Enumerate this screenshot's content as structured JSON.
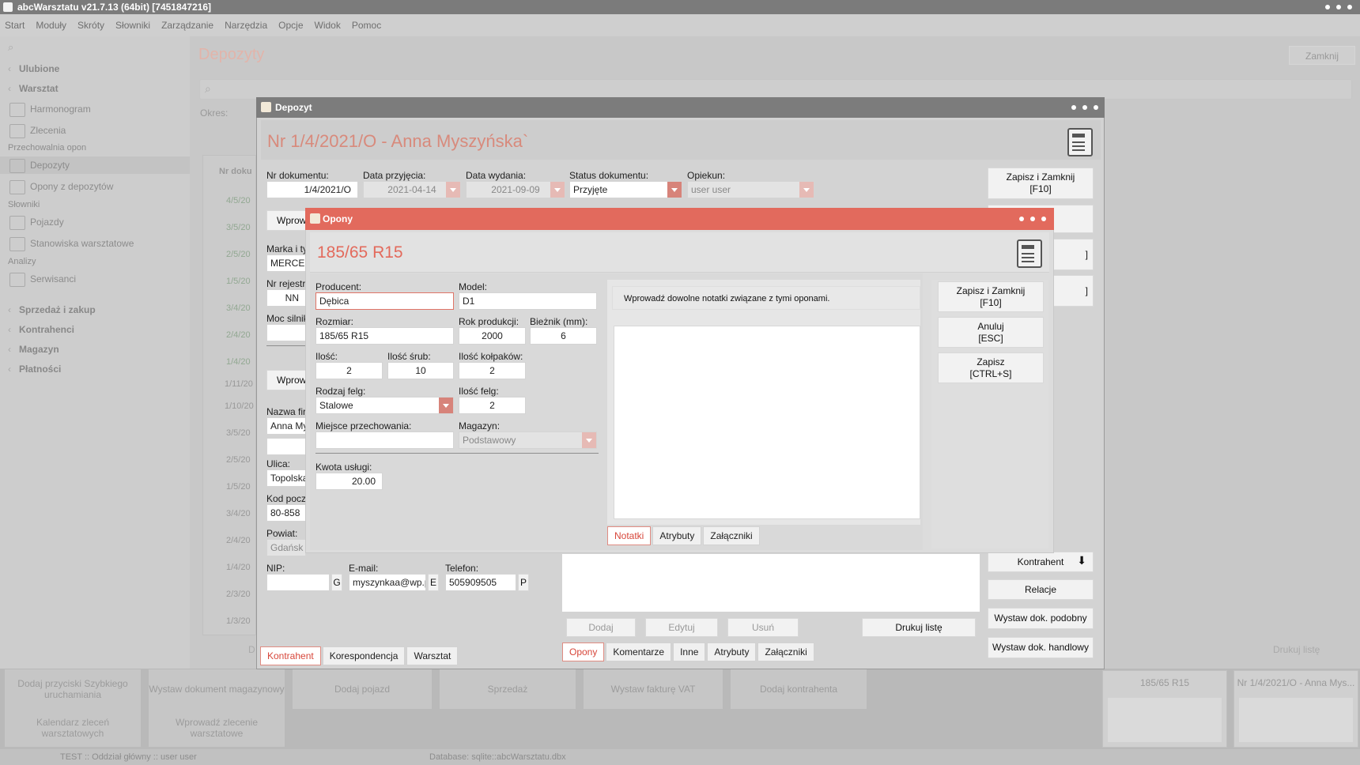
{
  "app": {
    "title": "abcWarsztatu v21.7.13 (64bit) [7451847216]",
    "menu": [
      "Start",
      "Moduły",
      "Skróty",
      "Słowniki",
      "Zarządzanie",
      "Narzędzia",
      "Opcje",
      "Widok",
      "Pomoc"
    ]
  },
  "sidebar": {
    "ulubione": "Ulubione",
    "warsztat": "Warsztat",
    "harmonogram": "Harmonogram",
    "zlecenia": "Zlecenia",
    "przechowalnia": "Przechowalnia opon",
    "depozyty": "Depozyty",
    "opony_z_depozytow": "Opony z depozytów",
    "slowniki": "Słowniki",
    "pojazdy": "Pojazdy",
    "stanowiska": "Stanowiska warsztatowe",
    "analizy": "Analizy",
    "serwisanci": "Serwisanci",
    "sprzedaz": "Sprzedaż i zakup",
    "kontrahenci": "Kontrahenci",
    "magazyn": "Magazyn",
    "platnosci": "Płatności"
  },
  "bg": {
    "page_title": "Depozyty",
    "close": "Zamknij",
    "okres": "Okres:",
    "col_nr": "Nr doku",
    "rows": [
      "4/5/20",
      "3/5/20",
      "2/5/20",
      "1/5/20",
      "3/4/20",
      "2/4/20",
      "1/4/20",
      "1/11/20",
      "1/10/20",
      "3/5/20",
      "2/5/20",
      "1/5/20",
      "3/4/20",
      "2/4/20",
      "1/4/20",
      "2/3/20",
      "1/3/20"
    ],
    "drukuj_liste": "Drukuj listę",
    "d_label": "D"
  },
  "taskbar": {
    "buttons": [
      "Dodaj przyciski Szybkiego uruchamiania",
      "Wystaw dokument magazynowy",
      "Dodaj pojazd",
      "Sprzedaż",
      "Wystaw fakturę VAT",
      "Dodaj kontrahenta",
      "Kalendarz zleceń warsztatowych",
      "Wprowadź zlecenie warsztatowe"
    ],
    "thumb1": "185/65 R15",
    "thumb2": "Nr 1/4/2021/O - Anna Mys..."
  },
  "status": {
    "left": "TEST :: Oddział główny :: user user",
    "db": "Database: sqlite::abcWarsztatu.dbx"
  },
  "depozyt": {
    "window_title": "Depozyt",
    "header": "Nr 1/4/2021/O - Anna Myszyńska`",
    "nr_label": "Nr dokumentu:",
    "nr_value": "1/4/2021/O",
    "przyjecia_label": "Data przyjęcia:",
    "przyjecia_value": "2021-04-14",
    "wydania_label": "Data wydania:",
    "wydania_value": "2021-09-09",
    "status_label": "Status dokumentu:",
    "status_value": "Przyjęte",
    "opiekun_label": "Opiekun:",
    "opiekun_value": "user user",
    "wprowadz1": "Wprowa",
    "marka_label": "Marka i ty",
    "marka_value": "MERCED",
    "nrrej_label": "Nr rejestr",
    "nrrej_value": "NN",
    "moc_label": "Moc silnik",
    "wprowadz2": "Wprowa",
    "nazwa_label": "Nazwa fir",
    "nazwa_value": "Anna My",
    "ulica_label": "Ulica:",
    "ulica_value": "Topolska",
    "kod_label": "Kod pocz",
    "kod_value": "80-858",
    "powiat_label": "Powiat:",
    "powiat_value": "Gdańsk",
    "nip_label": "NIP:",
    "nip_btn": "G",
    "email_label": "E-mail:",
    "email_value": "myszynkaa@wp.p",
    "email_btn": "E",
    "telefon_label": "Telefon:",
    "telefon_value": "505909505",
    "telefon_btn": "P",
    "tabs_left": [
      "Kontrahent",
      "Korespondencja",
      "Warsztat"
    ],
    "tabs_right": [
      "Opony",
      "Komentarze",
      "Inne",
      "Atrybuty",
      "Załączniki"
    ],
    "dodaj": "Dodaj",
    "edytuj": "Edytuj",
    "usun": "Usuń",
    "drukuj": "Drukuj listę",
    "zapisz_zamknij": "Zapisz i Zamknij",
    "zapisz_zamknij_key": "[F10]",
    "kontrahent": "Kontrahent",
    "relacje": "Relacje",
    "wystaw_podobny": "Wystaw dok. podobny",
    "wystaw_handlowy": "Wystaw dok. handlowy",
    "hidden_btn1": "]",
    "hidden_btn2": "]"
  },
  "opony": {
    "window_title": "Opony",
    "header": "185/65 R15",
    "producent_label": "Producent:",
    "producent_value": "Dębica",
    "model_label": "Model:",
    "model_value": "D1",
    "rozmiar_label": "Rozmiar:",
    "rozmiar_value": "185/65 R15",
    "rok_label": "Rok produkcji:",
    "rok_value": "2000",
    "biez_label": "Bieżnik (mm):",
    "biez_value": "6",
    "ilosc_label": "Ilość:",
    "ilosc_value": "2",
    "srub_label": "Ilość śrub:",
    "srub_value": "10",
    "kolp_label": "Ilość kołpaków:",
    "kolp_value": "2",
    "felg_type_label": "Rodzaj felg:",
    "felg_type_value": "Stalowe",
    "felg_qty_label": "Ilość felg:",
    "felg_qty_value": "2",
    "miejsce_label": "Miejsce przechowania:",
    "miejsce_value": "",
    "magazyn_label": "Magazyn:",
    "magazyn_value": "Podstawowy",
    "kwota_label": "Kwota usługi:",
    "kwota_value": "20.00",
    "notes_hint": "Wprowadź dowolne notatki związane z tymi oponami.",
    "tabs": [
      "Notatki",
      "Atrybuty",
      "Załączniki"
    ],
    "zapisz_zamknij": "Zapisz i Zamknij",
    "zapisz_zamknij_key": "[F10]",
    "anuluj": "Anuluj",
    "anuluj_key": "[ESC]",
    "zapisz": "Zapisz",
    "zapisz_key": "[CTRL+S]"
  },
  "colors": {
    "accent": "#e26a5d",
    "header_text": "#e36a5c",
    "background": "#b9b9b9"
  }
}
